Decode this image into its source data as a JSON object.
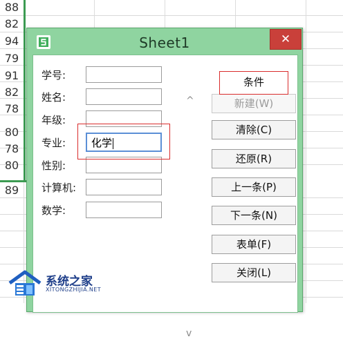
{
  "sheet": {
    "row_values": [
      "88",
      "82",
      "94",
      "79",
      "91",
      "82",
      "78",
      "80",
      "78",
      "80",
      "89"
    ]
  },
  "dialog": {
    "title": "Sheet1",
    "close_label": "✕",
    "fields": [
      {
        "label": "学号:",
        "value": ""
      },
      {
        "label": "姓名:",
        "value": ""
      },
      {
        "label": "年级:",
        "value": ""
      },
      {
        "label": "专业:",
        "value": "化学"
      },
      {
        "label": "性别:",
        "value": ""
      },
      {
        "label": "计算机:",
        "value": ""
      },
      {
        "label": "数学:",
        "value": ""
      }
    ],
    "buttons": {
      "criteria": "条件",
      "new": "新建(W)",
      "clear": "清除(C)",
      "restore": "还原(R)",
      "prev": "上一条(P)",
      "next": "下一条(N)",
      "form": "表单(F)",
      "close": "关闭(L)"
    },
    "scroll_up": "^",
    "scroll_down": "v"
  },
  "watermark": {
    "text": "系统之家",
    "sub": "XITONGZHIJIA.NET"
  },
  "colors": {
    "title_bar": "#8fd4a0",
    "close_button": "#c9403a",
    "highlight": "#d92b2b",
    "selection": "#3c9b52"
  }
}
